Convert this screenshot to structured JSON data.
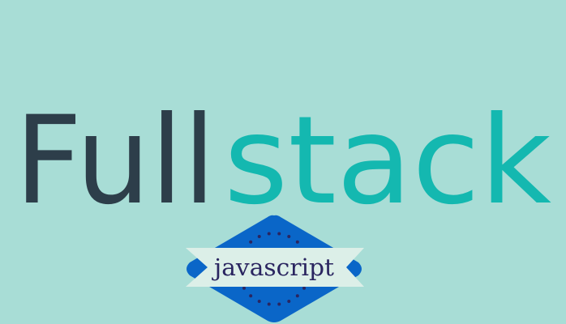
{
  "title": {
    "part1": "Full",
    "part2": "stack"
  },
  "badge": {
    "label": "javascript"
  },
  "colors": {
    "background": "#a8ddd6",
    "part1": "#2d3e4a",
    "part2": "#14b8b0",
    "badge_diamond": "#0a66c8",
    "ribbon": "#dcefe8",
    "badge_text": "#2a2560",
    "dots": "#2a2560"
  }
}
